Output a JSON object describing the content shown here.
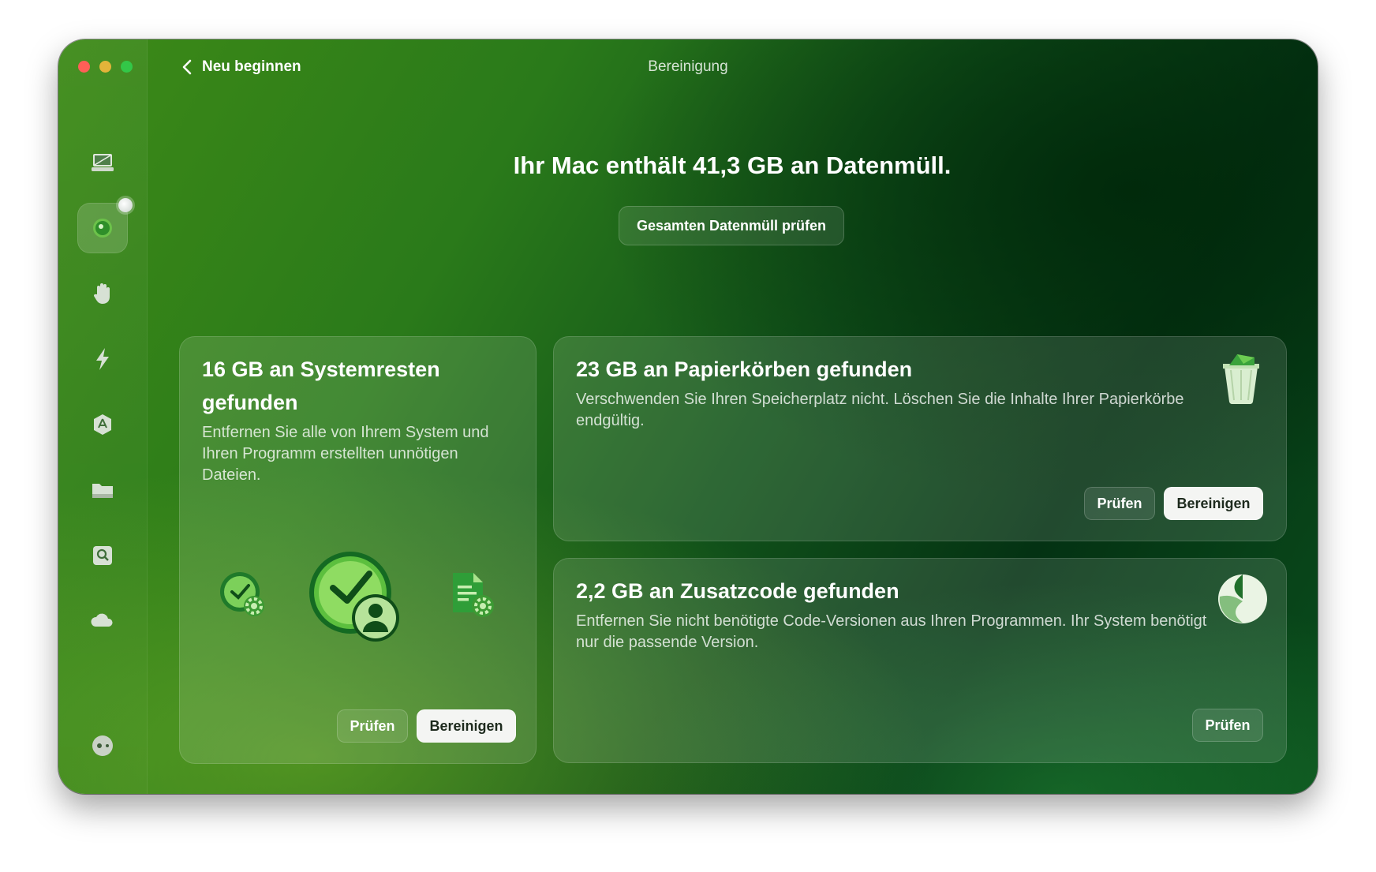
{
  "window": {
    "title": "Bereinigung",
    "back_label": "Neu beginnen"
  },
  "sidebar": {
    "items": [
      {
        "name": "smart-scan-icon"
      },
      {
        "name": "cleanup-icon",
        "active": true
      },
      {
        "name": "protection-icon"
      },
      {
        "name": "performance-icon"
      },
      {
        "name": "applications-icon"
      },
      {
        "name": "my-clutter-icon"
      },
      {
        "name": "space-lens-icon"
      },
      {
        "name": "cloud-cleanup-icon"
      },
      {
        "name": "assistant-icon"
      }
    ]
  },
  "main": {
    "headline": "Ihr Mac enthält 41,3 GB an Datenmüll.",
    "review_all_label": "Gesamten Datenmüll prüfen"
  },
  "cards": {
    "system": {
      "title": "16 GB an Systemresten gefunden",
      "description": "Entfernen Sie alle von Ihrem System und Ihren Programm erstellten unnötigen Dateien.",
      "review_label": "Prüfen",
      "clean_label": "Bereinigen"
    },
    "trash": {
      "title": "23 GB an Papierkörben gefunden",
      "description": "Verschwenden Sie Ihren Speicherplatz nicht. Löschen Sie die Inhalte Ihrer Papierkörbe endgültig.",
      "review_label": "Prüfen",
      "clean_label": "Bereinigen"
    },
    "binaries": {
      "title": "2,2 GB an Zusatzcode gefunden",
      "description": "Entfernen Sie nicht benötigte Code-Versionen aus Ihren Programmen. Ihr System benötigt nur die passende Version.",
      "review_label": "Prüfen"
    }
  },
  "colors": {
    "accent_green": "#3fa535",
    "button_light": "#f4f5f3"
  }
}
